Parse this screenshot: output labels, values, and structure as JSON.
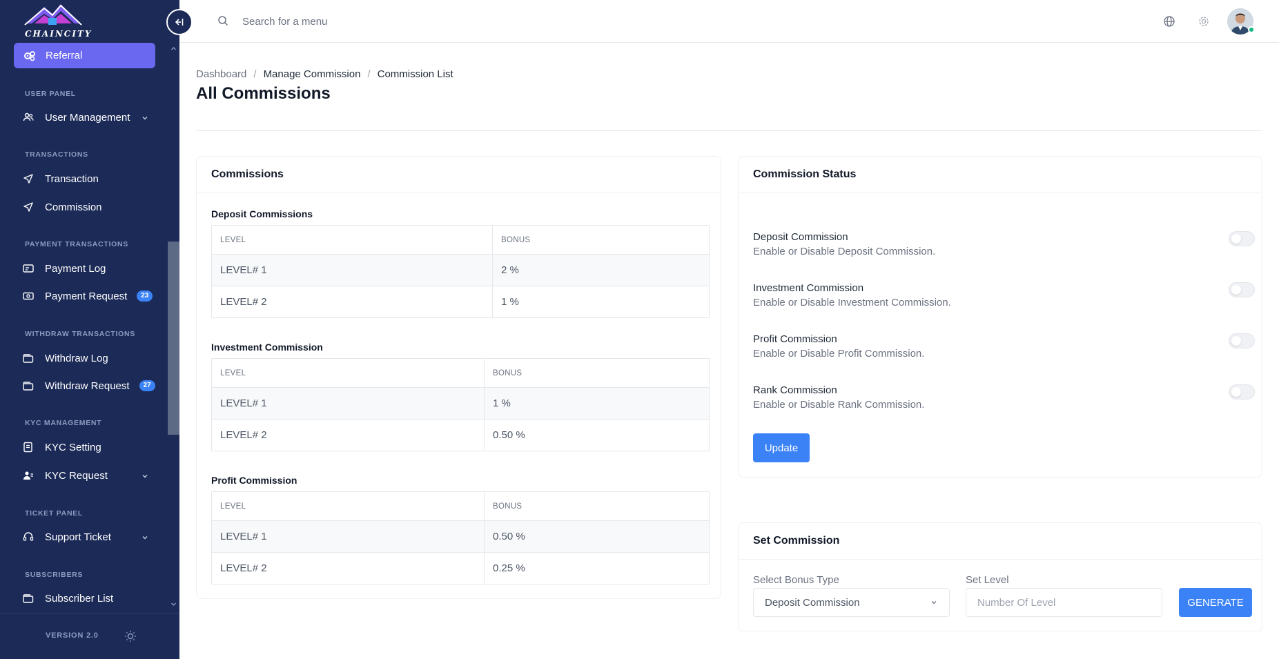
{
  "brand": {
    "logo_text": "CHAINCITY"
  },
  "sidebar": {
    "active_item": {
      "label": "Referral",
      "icon": "gear-icon"
    },
    "sections": [
      {
        "header": "USER PANEL"
      },
      {
        "header": "TRANSACTIONS"
      },
      {
        "header": "PAYMENT TRANSACTIONS"
      },
      {
        "header": "WITHDRAW TRANSACTIONS"
      },
      {
        "header": "KYC MANAGEMENT"
      },
      {
        "header": "TICKET PANEL"
      },
      {
        "header": "SUBSCRIBERS"
      }
    ],
    "items": [
      {
        "label": "User Management",
        "icon": "users-icon",
        "chevron": true
      },
      {
        "label": "Transaction",
        "icon": "send-icon"
      },
      {
        "label": "Commission",
        "icon": "send-icon"
      },
      {
        "label": "Payment Log",
        "icon": "card-icon"
      },
      {
        "label": "Payment Request",
        "icon": "cash-icon",
        "badge": "23"
      },
      {
        "label": "Withdraw Log",
        "icon": "wallet-icon"
      },
      {
        "label": "Withdraw Request",
        "icon": "wallet-icon",
        "badge": "27"
      },
      {
        "label": "KYC Setting",
        "icon": "id-card-icon"
      },
      {
        "label": "KYC Request",
        "icon": "user-check-icon",
        "chevron": true
      },
      {
        "label": "Support Ticket",
        "icon": "headset-icon",
        "chevron": true
      },
      {
        "label": "Subscriber List",
        "icon": "inbox-icon"
      }
    ],
    "version": "VERSION 2.0"
  },
  "topbar": {
    "search_placeholder": "Search for a menu"
  },
  "breadcrumb": {
    "items": [
      "Dashboard",
      "Manage Commission",
      "Commission List"
    ],
    "separator": "/"
  },
  "page_title": "All Commissions",
  "commissions_card": {
    "title": "Commissions",
    "tables": [
      {
        "title": "Deposit Commissions",
        "headers": [
          "LEVEL",
          "BONUS"
        ],
        "rows": [
          [
            "LEVEL# 1",
            "2 %"
          ],
          [
            "LEVEL# 2",
            "1 %"
          ]
        ]
      },
      {
        "title": "Investment Commission",
        "headers": [
          "LEVEL",
          "BONUS"
        ],
        "rows": [
          [
            "LEVEL# 1",
            "1 %"
          ],
          [
            "LEVEL# 2",
            "0.50 %"
          ]
        ]
      },
      {
        "title": "Profit Commission",
        "headers": [
          "LEVEL",
          "BONUS"
        ],
        "rows": [
          [
            "LEVEL# 1",
            "0.50 %"
          ],
          [
            "LEVEL# 2",
            "0.25 %"
          ]
        ]
      }
    ]
  },
  "status_card": {
    "title": "Commission Status",
    "items": [
      {
        "title": "Deposit Commission",
        "desc": "Enable or Disable Deposit Commission.",
        "enabled": false
      },
      {
        "title": "Investment Commission",
        "desc": "Enable or Disable Investment Commission.",
        "enabled": false
      },
      {
        "title": "Profit Commission",
        "desc": "Enable or Disable Profit Commission.",
        "enabled": false
      },
      {
        "title": "Rank Commission",
        "desc": "Enable or Disable Rank Commission.",
        "enabled": false
      }
    ],
    "update_label": "Update"
  },
  "set_commission": {
    "title": "Set Commission",
    "bonus_type_label": "Select Bonus Type",
    "bonus_type_value": "Deposit Commission",
    "level_label": "Set Level",
    "level_placeholder": "Number Of Level",
    "generate_label": "GENERATE"
  },
  "colors": {
    "sidebar_bg": "#1b2a57",
    "active_item": "#6a68f0",
    "primary": "#3b82f6",
    "online": "#10b981"
  }
}
